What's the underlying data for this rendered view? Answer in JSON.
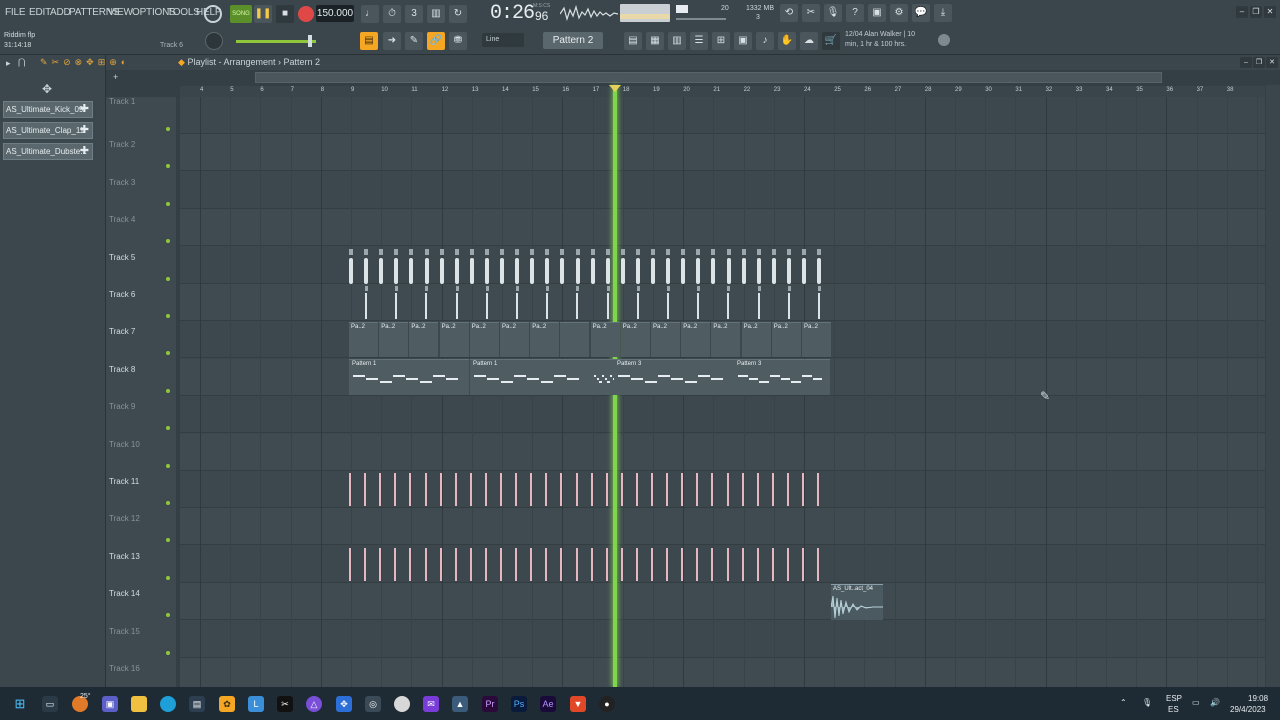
{
  "app": {
    "project": "Riddim flp",
    "project_time": "31:14:18",
    "hint_track": "Track 6"
  },
  "menu": [
    "FILE",
    "EDIT",
    "ADD",
    "PATTERNS",
    "VIEW",
    "OPTIONS",
    "TOOLS",
    "HELP"
  ],
  "transport": {
    "mode": "SONG",
    "tempo": "150.000",
    "time": "0:26",
    "time_fraction": "96",
    "time_unit": "M:S:CS",
    "cpu_label": "20",
    "memory": "1332 MB",
    "polyphony": "3"
  },
  "snap": {
    "label": "Line"
  },
  "pattern_selector": {
    "label": "Pattern 2"
  },
  "hint": {
    "line1": "12/04  Alan Walker | 10",
    "line2": "min, 1 hr & 100 hrs."
  },
  "playlist": {
    "title": "Playlist - Arrangement",
    "separator": "›",
    "current": "Pattern 2"
  },
  "channels": [
    {
      "label": "AS_Ultimate_Kick_09"
    },
    {
      "label": "AS_Ultimate_Clap_11"
    },
    {
      "label": "AS_Ultimate_Dubste..."
    }
  ],
  "ruler": [
    "4",
    "5",
    "6",
    "7",
    "8",
    "9",
    "10",
    "11",
    "12",
    "13",
    "14",
    "15",
    "16",
    "17",
    "18",
    "19",
    "20",
    "21",
    "22",
    "23",
    "24",
    "25",
    "26",
    "27",
    "28",
    "29",
    "30",
    "31",
    "32",
    "33",
    "34",
    "35",
    "36",
    "37",
    "38"
  ],
  "tracks": [
    {
      "label": "Track 1",
      "dim": true
    },
    {
      "label": "Track 2",
      "dim": true
    },
    {
      "label": "Track 3",
      "dim": true
    },
    {
      "label": "Track 4",
      "dim": true
    },
    {
      "label": "Track 5",
      "dim": false
    },
    {
      "label": "Track 6",
      "dim": false
    },
    {
      "label": "Track 7",
      "dim": false
    },
    {
      "label": "Track 8",
      "dim": false
    },
    {
      "label": "Track 9",
      "dim": true
    },
    {
      "label": "Track 10",
      "dim": true
    },
    {
      "label": "Track 11",
      "dim": false
    },
    {
      "label": "Track 12",
      "dim": true
    },
    {
      "label": "Track 13",
      "dim": false
    },
    {
      "label": "Track 14",
      "dim": false
    },
    {
      "label": "Track 15",
      "dim": true
    },
    {
      "label": "Track 16",
      "dim": true
    }
  ],
  "clips": {
    "pattern_short": "Pa..2",
    "pattern1": "Pattern 1",
    "pattern3": "Pattern 3",
    "audio": "AS_Ult..act_04"
  },
  "taskbar": {
    "weather": "25°",
    "lang_top": "ESP",
    "lang_bottom": "ES",
    "clock": "19:08",
    "date": "29/4/2023"
  },
  "colors": {
    "accent": "#7fd64b",
    "orange": "#f5a623",
    "record": "#e04848"
  }
}
